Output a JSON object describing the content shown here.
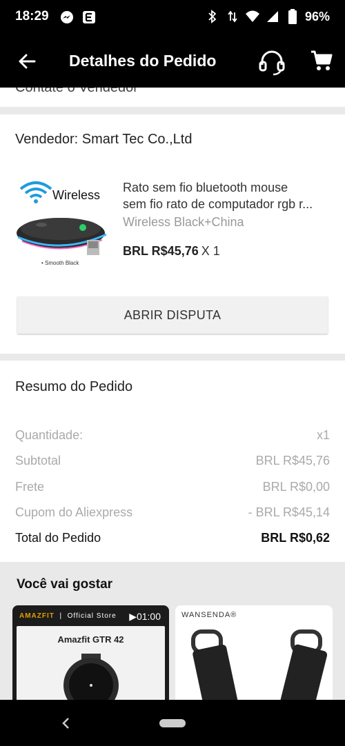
{
  "status_bar": {
    "time": "18:29",
    "battery": "96%",
    "left_icons": [
      "messenger-icon",
      "app-e-icon"
    ],
    "right_icons": [
      "bluetooth-icon",
      "data-arrows-icon",
      "wifi-icon",
      "signal-icon",
      "battery-icon"
    ]
  },
  "app_bar": {
    "title": "Detalhes do Pedido",
    "icons": [
      "back-arrow-icon",
      "headset-support-icon",
      "cart-icon"
    ]
  },
  "partial_row": {
    "text": "Contate o Vendedor"
  },
  "vendor": {
    "label": "Vendedor: Smart Tec Co.,Ltd"
  },
  "product": {
    "title_line1": "Rato sem fio bluetooth mouse",
    "title_line2": "sem fio rato de computador rgb r...",
    "variant": "Wireless Black+China",
    "price": "BRL R$45,76",
    "quantity": "X 1",
    "image_text_top": "Wireless",
    "image_text_bottom": "• Smooth Black"
  },
  "actions": {
    "dispute_label": "ABRIR DISPUTA"
  },
  "summary": {
    "title": "Resumo do Pedido",
    "rows": [
      {
        "label": "Quantidade:",
        "value": "x1"
      },
      {
        "label": "Subtotal",
        "value": "BRL R$45,76"
      },
      {
        "label": "Frete",
        "value": "BRL R$0,00"
      },
      {
        "label": "Cupom do Aliexpress",
        "value": "- BRL R$45,14"
      },
      {
        "label": "Total do Pedido",
        "value": "BRL R$0,62"
      }
    ]
  },
  "recommendations": {
    "title": "Você vai gostar",
    "card1": {
      "brand": "AMAZFIT",
      "store": "Official Store",
      "video_duration": "▶01:00",
      "model": "Amazfit GTR 42"
    },
    "card2": {
      "brand": "WANSENDA®"
    }
  },
  "colors": {
    "bars": "#000000",
    "background": "#e9e9e9",
    "card": "#ffffff",
    "muted_text": "#aaaaaa"
  }
}
